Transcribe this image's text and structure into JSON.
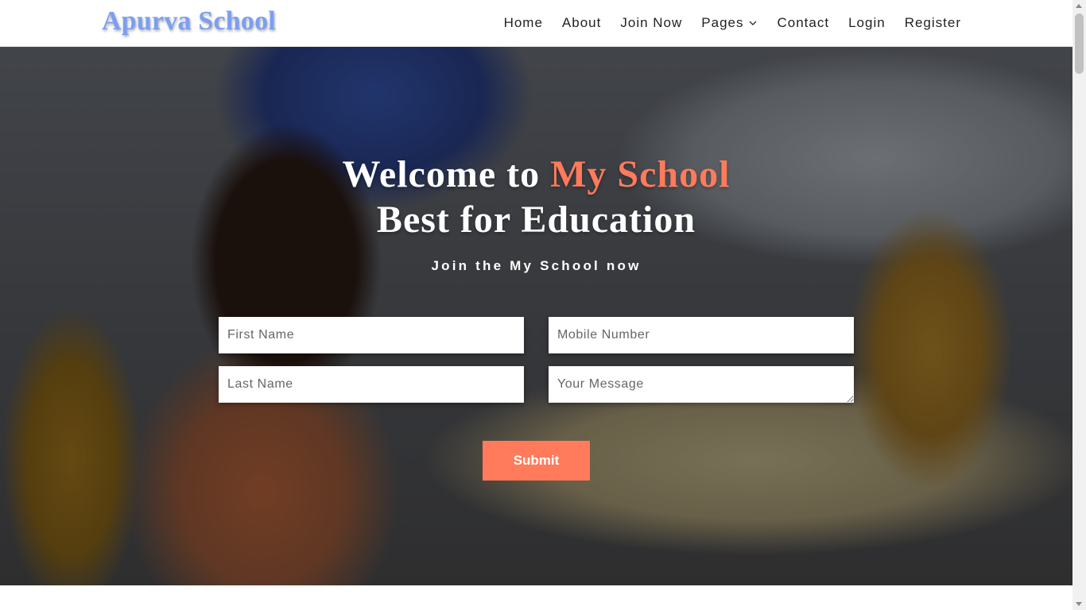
{
  "brand": {
    "name": "Apurva School",
    "color": "#7b9ff0"
  },
  "nav": {
    "items": [
      {
        "label": "Home"
      },
      {
        "label": "About"
      },
      {
        "label": "Join Now"
      },
      {
        "label": "Pages",
        "dropdown": true,
        "icon": "chevron-down-icon"
      },
      {
        "label": "Contact"
      },
      {
        "label": "Login"
      },
      {
        "label": "Register"
      }
    ]
  },
  "hero": {
    "title_prefix": "Welcome to ",
    "title_accent": "My School",
    "title_line2": "Best for Education",
    "subtitle": "Join the My School now",
    "accent_color": "#ff7b5b"
  },
  "form": {
    "first_name_placeholder": "First Name",
    "mobile_placeholder": "Mobile Number",
    "last_name_placeholder": "Last Name",
    "message_placeholder": "Your Message",
    "submit_label": "Submit"
  }
}
